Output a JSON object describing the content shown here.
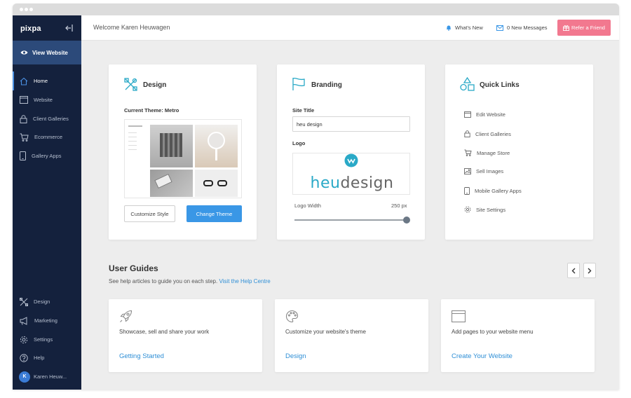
{
  "sidebar": {
    "brand": "pixpa",
    "view_website": "View Website",
    "nav_items": [
      {
        "label": "Home"
      },
      {
        "label": "Website"
      },
      {
        "label": "Client Galleries"
      },
      {
        "label": "Ecommerce"
      },
      {
        "label": "Gallery Apps"
      }
    ],
    "bottom_items": [
      {
        "label": "Design"
      },
      {
        "label": "Marketing"
      },
      {
        "label": "Settings"
      },
      {
        "label": "Help"
      }
    ],
    "user": {
      "initial": "K",
      "name": "Karen Heuw..."
    }
  },
  "topbar": {
    "welcome": "Welcome Karen Heuwagen",
    "whats_new": "What's New",
    "messages": "0 New Messages",
    "refer": "Refer a Friend"
  },
  "design_card": {
    "title": "Design",
    "current_theme": "Current Theme: Metro",
    "customize_style": "Customize Style",
    "change_theme": "Change Theme"
  },
  "branding_card": {
    "title": "Branding",
    "site_title_label": "Site Title",
    "site_title_value": "heu design",
    "logo_label": "Logo",
    "logo_text_a": "heu",
    "logo_text_b": "design",
    "logo_width_label": "Logo Width",
    "logo_width_value": "250 px",
    "logo_width_fraction": 1.0
  },
  "quick_links": {
    "title": "Quick Links",
    "items": [
      {
        "label": "Edit Website"
      },
      {
        "label": "Client Galleries"
      },
      {
        "label": "Manage Store"
      },
      {
        "label": "Sell Images"
      },
      {
        "label": "Mobile Gallery Apps"
      },
      {
        "label": "Site Settings"
      }
    ]
  },
  "user_guides": {
    "title": "User Guides",
    "subtitle": "See help articles to guide you on each step.",
    "help_link": "Visit the Help Centre",
    "cards": [
      {
        "text": "Showcase, sell and share your work",
        "link": "Getting Started"
      },
      {
        "text": "Customize your website's theme",
        "link": "Design"
      },
      {
        "text": "Add pages to your website menu",
        "link": "Create Your Website"
      }
    ]
  },
  "colors": {
    "sidebar_bg": "#14213d",
    "accent_blue": "#3a97e6",
    "refer_pink": "#f2788f",
    "icon_teal": "#2aa9c7"
  }
}
